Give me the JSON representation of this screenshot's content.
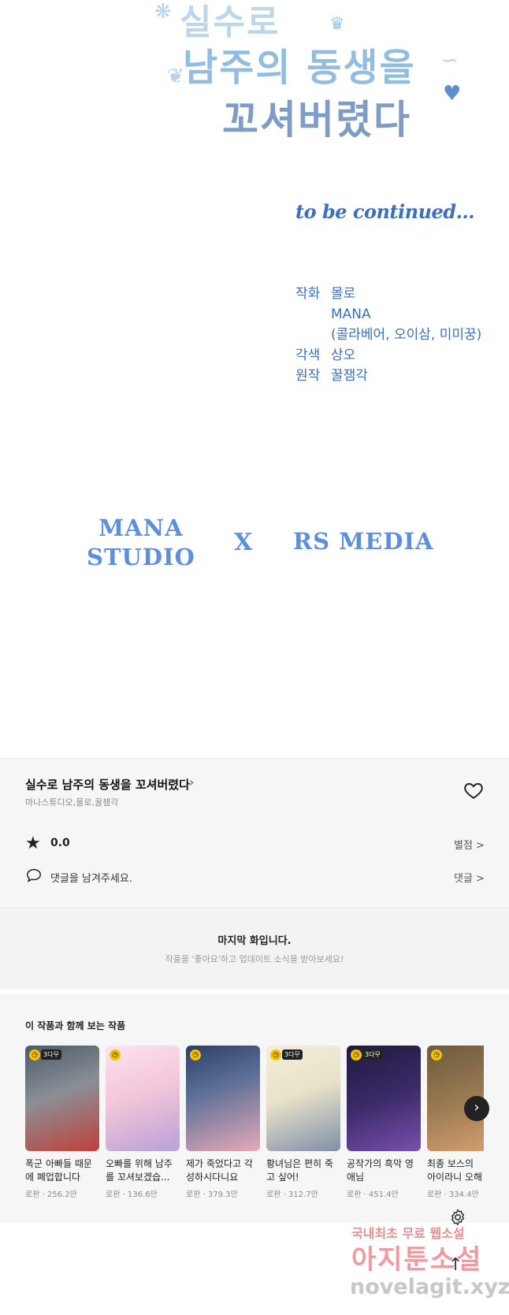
{
  "comic": {
    "logo_line1": "실수로",
    "logo_line2": "남주의 동생을",
    "logo_line3": "꼬셔버렸다",
    "to_be_continued": "to be continued...",
    "credits": [
      {
        "role": "작화",
        "names": [
          "몰로",
          "MANA",
          "(콜라베어, 오이삼, 미미꿍)"
        ]
      },
      {
        "role": "각색",
        "names": [
          "상오"
        ]
      },
      {
        "role": "원작",
        "names": [
          "꿀잼각"
        ]
      }
    ],
    "studio_left_line1": "MANA",
    "studio_left_line2": "STUDIO",
    "studio_x": "X",
    "studio_right": "RS MEDIA"
  },
  "work": {
    "title": "실수로 남주의 동생을 꼬셔버렸다",
    "authors": "마나스튜디오,몰로,꿀잼각",
    "rating": "0.0",
    "rate_link": "별점 >",
    "comment_prompt": "댓글을 남겨주세요.",
    "comment_link": "댓글 >"
  },
  "notice": {
    "last_episode": "마지막 화입니다.",
    "subscribe_msg": "작품을 '좋아요'하고 업데이트 소식을 받아보세요!"
  },
  "recommend": {
    "heading": "이 작품과 함께 보는 작품",
    "cards": [
      {
        "title": "폭군 아빠들 때문에 폐업합니다",
        "meta": "로판 · 256.2만",
        "badge": "3다무",
        "color1": "#4a5a6a",
        "color2": "#c0403a"
      },
      {
        "title": "오빠를 위해 남주를 꼬셔보겠습...",
        "meta": "로판 · 136.6만",
        "badge": "",
        "color1": "#f3c7d9",
        "color2": "#b9a0d8"
      },
      {
        "title": "제가 죽었다고 각성하시다니요",
        "meta": "로판 · 379.3만",
        "badge": "",
        "color1": "#2c3f66",
        "color2": "#e7a9b9"
      },
      {
        "title": "황녀님은 편히 죽고 싶어!",
        "meta": "로판 · 312.7만",
        "badge": "3다무",
        "color1": "#e9e2c9",
        "color2": "#7f8fa8"
      },
      {
        "title": "공작가의 흑막 영애님",
        "meta": "로판 · 451.4만",
        "badge": "3다무",
        "color1": "#1f1a3e",
        "color2": "#7a4fae"
      },
      {
        "title": "최종 보스의 아이라니 오해입",
        "meta": "로판 · 334.4만",
        "badge": "",
        "color1": "#6b5a3c",
        "color2": "#d9a170"
      }
    ]
  },
  "watermark": {
    "line1": "국내최초 무료 웹소설",
    "line2": "아지툰소설",
    "line3": "novelagit.xyz"
  }
}
